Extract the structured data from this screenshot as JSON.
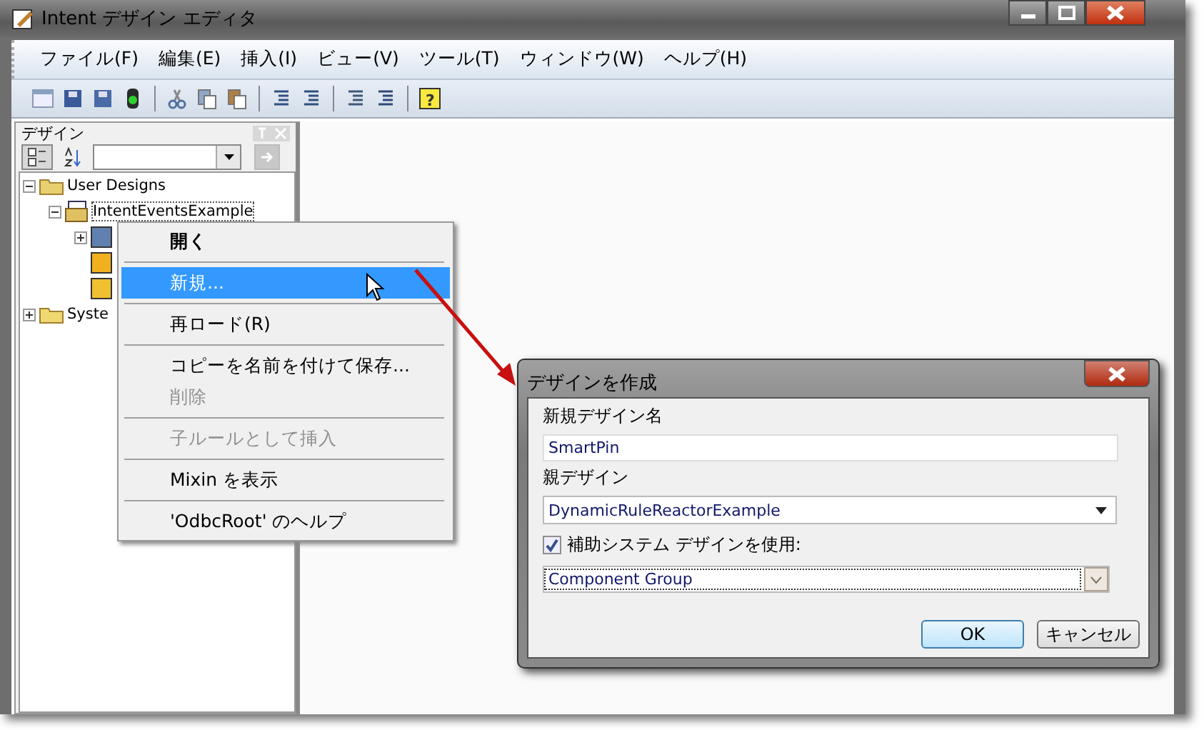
{
  "window": {
    "title": "Intent デザイン エディタ"
  },
  "menu_bar": [
    "ファイル(F)",
    "編集(E)",
    "挿入(I)",
    "ビュー(V)",
    "ツール(T)",
    "ウィンドウ(W)",
    "ヘルプ(H)"
  ],
  "toolbar": [
    {
      "kind": "grid"
    },
    {
      "kind": "save"
    },
    {
      "kind": "save-all"
    },
    {
      "kind": "traffic-light"
    },
    {
      "kind": "sep"
    },
    {
      "kind": "cut"
    },
    {
      "kind": "copy"
    },
    {
      "kind": "paste"
    },
    {
      "kind": "sep"
    },
    {
      "kind": "outdent"
    },
    {
      "kind": "indent"
    },
    {
      "kind": "sep"
    },
    {
      "kind": "lines"
    },
    {
      "kind": "undo-lines"
    },
    {
      "kind": "sep"
    },
    {
      "kind": "help",
      "label": "?"
    }
  ],
  "side_panel": {
    "title": "デザイン",
    "view_buttons": [
      {
        "kind": "categorized",
        "selected": true
      },
      {
        "kind": "sort",
        "selected": false
      }
    ],
    "go_disabled": true,
    "tree": [
      {
        "label": "User Designs",
        "kind": "folder-open",
        "expanded": true,
        "children": [
          {
            "label": "IntentEventsExample",
            "kind": "design",
            "expanded": true,
            "children": [
              {
                "kind": "list",
                "expanded": false
              },
              {
                "kind": "cube"
              },
              {
                "kind": "doc"
              }
            ]
          }
        ]
      },
      {
        "label": "Syste",
        "kind": "folder",
        "expanded": false
      }
    ]
  },
  "context_menu": [
    {
      "kind": "item",
      "label": "開く",
      "bold": true,
      "selected": false,
      "disabled": false
    },
    {
      "kind": "separator"
    },
    {
      "kind": "item",
      "label": "新規...",
      "bold": false,
      "selected": true,
      "disabled": false
    },
    {
      "kind": "separator"
    },
    {
      "kind": "item",
      "label": "再ロード(R)",
      "bold": false,
      "selected": false,
      "disabled": false
    },
    {
      "kind": "separator"
    },
    {
      "kind": "item",
      "label": "コピーを名前を付けて保存...",
      "bold": false,
      "selected": false,
      "disabled": false
    },
    {
      "kind": "item",
      "label": "削除",
      "bold": false,
      "selected": false,
      "disabled": true
    },
    {
      "kind": "separator"
    },
    {
      "kind": "item",
      "label": "子ルールとして挿入",
      "bold": false,
      "selected": false,
      "disabled": true
    },
    {
      "kind": "separator"
    },
    {
      "kind": "item",
      "label": "Mixin を表示",
      "bold": false,
      "selected": false,
      "disabled": false
    },
    {
      "kind": "separator"
    },
    {
      "kind": "item",
      "label": "'OdbcRoot' のヘルプ",
      "bold": false,
      "selected": false,
      "disabled": false
    }
  ],
  "dialog": {
    "title": "デザインを作成",
    "name_label": "新規デザイン名",
    "name_value": "SmartPin",
    "parent_label": "親デザイン",
    "parent_value": "DynamicRuleReactorExample",
    "use_checkbox": {
      "label": "補助システム デザインを使用:",
      "checked": true
    },
    "system_value": "Component Group",
    "buttons": [
      {
        "label": "OK",
        "default": true
      },
      {
        "label": "キャンセル",
        "default": false
      }
    ]
  }
}
